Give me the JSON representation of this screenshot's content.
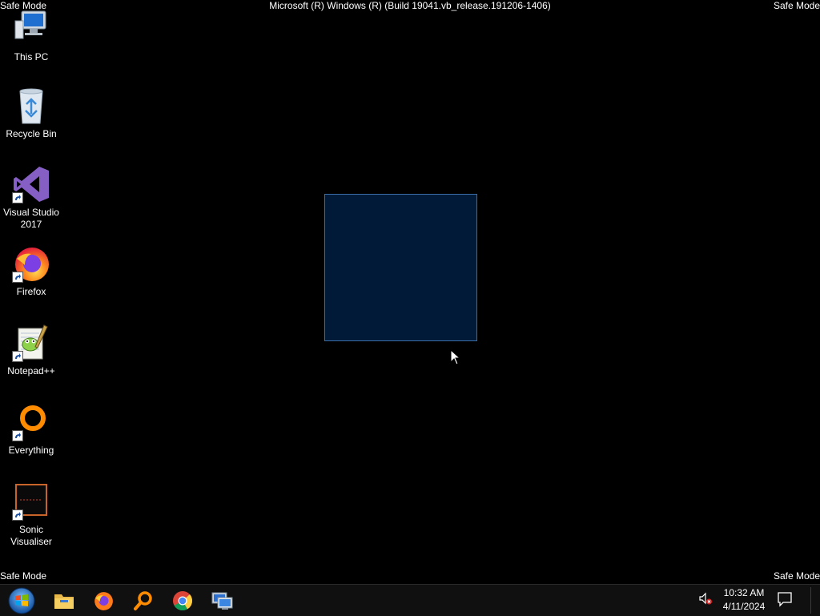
{
  "watermark": {
    "top_left": "Safe Mode",
    "top_right": "Safe Mode",
    "bottom_left": "Safe Mode",
    "bottom_right": "Safe Mode",
    "title": "Microsoft (R) Windows (R) (Build 19041.vb_release.191206-1406)"
  },
  "desktop": {
    "icons": [
      {
        "label": "This PC",
        "icon": "computer-icon"
      },
      {
        "label": "Recycle Bin",
        "icon": "recycle-bin-icon"
      },
      {
        "label": "Visual Studio 2017",
        "icon": "visual-studio-icon"
      },
      {
        "label": "Firefox",
        "icon": "firefox-icon"
      },
      {
        "label": "Notepad++",
        "icon": "notepad-plus-plus-icon"
      },
      {
        "label": "Everything",
        "icon": "everything-search-icon"
      },
      {
        "label": "Sonic Visualiser",
        "icon": "sonic-visualiser-icon"
      }
    ]
  },
  "taskbar": {
    "pinned": [
      {
        "name": "start",
        "icon": "windows-start-icon"
      },
      {
        "name": "File Explorer",
        "icon": "folder-icon"
      },
      {
        "name": "Firefox",
        "icon": "firefox-icon"
      },
      {
        "name": "Everything",
        "icon": "magnifier-icon"
      },
      {
        "name": "Chrome",
        "icon": "chrome-icon"
      },
      {
        "name": "Remote Desktop",
        "icon": "remote-desktop-icon"
      }
    ],
    "tray": {
      "time": "10:32 AM",
      "date": "4/11/2024",
      "volume_icon": "speaker-muted-icon",
      "notification_icon": "action-center-icon"
    }
  },
  "colors": {
    "desktop_bg": "#000000",
    "taskbar_bg": "#101010",
    "selection_fill": "#001a38",
    "selection_border": "#3a6ea8"
  }
}
